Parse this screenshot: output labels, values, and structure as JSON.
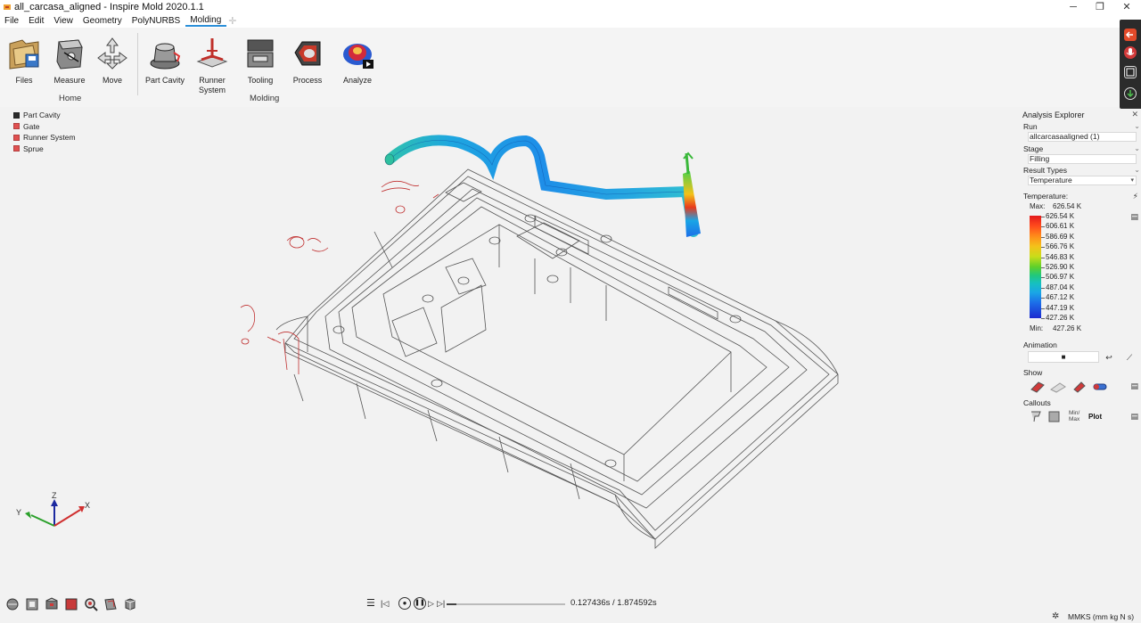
{
  "window": {
    "title": "all_carcasa_aligned - Inspire Mold 2020.1.1"
  },
  "menu": {
    "items": [
      "File",
      "Edit",
      "View",
      "Geometry",
      "PolyNURBS",
      "Molding"
    ],
    "active": "Molding"
  },
  "ribbon": {
    "tools": {
      "files": "Files",
      "measure": "Measure",
      "move": "Move",
      "part_cavity": "Part Cavity",
      "runner_system": "Runner\nSystem",
      "tooling": "Tooling",
      "process": "Process",
      "analyze": "Analyze"
    },
    "groups": {
      "home": "Home",
      "molding": "Molding"
    }
  },
  "legend": {
    "items": [
      {
        "label": "Part Cavity",
        "color": "#2b2b2b"
      },
      {
        "label": "Gate",
        "color": "#e05050"
      },
      {
        "label": "Runner System",
        "color": "#e05050"
      },
      {
        "label": "Sprue",
        "color": "#e05050"
      }
    ]
  },
  "analysis": {
    "title": "Analysis Explorer",
    "run_label": "Run",
    "run_value": "allcarcasaaligned (1)",
    "stage_label": "Stage",
    "stage_value": "Filling",
    "result_types_label": "Result Types",
    "result_value": "Temperature",
    "scale_title": "Temperature:",
    "max_label": "Max:",
    "max_value": "626.54 K",
    "min_label": "Min:",
    "min_value": "427.26 K",
    "scale_values": [
      "626.54 K",
      "606.61 K",
      "586.69 K",
      "566.76 K",
      "546.83 K",
      "526.90 K",
      "506.97 K",
      "487.04 K",
      "467.12 K",
      "447.19 K",
      "427.26 K"
    ],
    "animation_label": "Animation",
    "animation_value": "■",
    "show_label": "Show",
    "callouts_label": "Callouts",
    "callouts_minmax": "Min/\nMax",
    "callouts_plot": "Plot"
  },
  "axes": {
    "z": "Z",
    "y": "Y",
    "x": "X"
  },
  "playback": {
    "time": "0.127436s / 1.874592s"
  },
  "status": {
    "units": "MMKS (mm kg N s)"
  },
  "colors": {
    "accent": "#2a8fd9",
    "dock": "#2b2b2b",
    "dock_accent": "#e24a2a"
  }
}
